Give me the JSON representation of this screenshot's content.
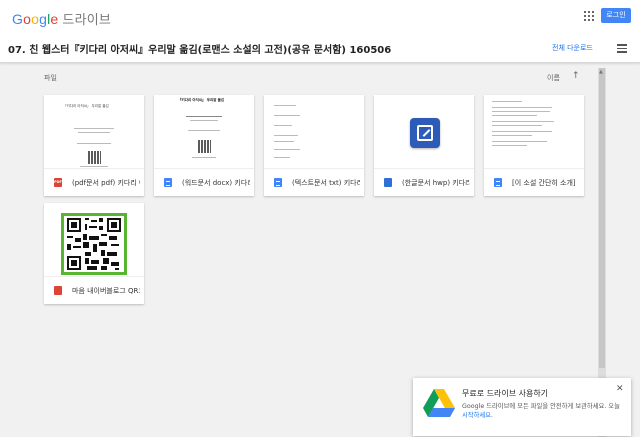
{
  "app": {
    "logo_letters": [
      "G",
      "o",
      "o",
      "g",
      "l",
      "e"
    ],
    "logo_colors": [
      "#4285f4",
      "#db4437",
      "#f4b400",
      "#4285f4",
      "#0f9d58",
      "#db4437"
    ],
    "product": "드라이브",
    "login_label": "로그인",
    "accent": "#4285f4"
  },
  "folder": {
    "title": "07. 친 웹스터『키다리 아저씨』우리말 옮김(로맨스 소설의 고전)(공유 문서함) 160506",
    "download_all": "전체 다운로드"
  },
  "files_section": {
    "label": "파일",
    "sort_label": "이름",
    "sort_icon": "arrow-up-icon"
  },
  "files": [
    {
      "name": "(pdf문서 pdf) 키다리 아저씨",
      "icon": "pdf-icon",
      "icon_text": "PDF",
      "thumb_title": "『키다리 아저씨』 우리말 옮김"
    },
    {
      "name": "(워드문서 docx) 키다리 아저씨",
      "icon": "docs-icon",
      "thumb_title": "『키다리 아저씨』 우리말 옮김"
    },
    {
      "name": "(텍스트문서 txt) 키다리 아저씨",
      "icon": "docs-icon"
    },
    {
      "name": "(한글문서 hwp) 키다리 아저씨",
      "icon": "hwp-icon"
    },
    {
      "name": "[이 소설 간단히 소개]",
      "icon": "docs-icon"
    },
    {
      "name": "마음 내이버블로그 QR코드",
      "icon": "image-icon"
    }
  ],
  "toast": {
    "title": "무료로 드라이브 사용하기",
    "body": "Google 드라이브에 모든 파일을 안전하게 보관하세요. 오늘",
    "link": "시작하세요",
    "suffix": ".",
    "close_icon": "close-icon"
  }
}
